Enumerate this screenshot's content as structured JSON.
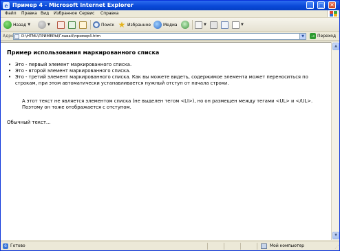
{
  "window": {
    "title": "Пример 4 - Microsoft Internet Explorer",
    "controls": {
      "minimize": "_",
      "maximize": "□",
      "close": "✕"
    }
  },
  "menubar": {
    "items": [
      "Файл",
      "Правка",
      "Вид",
      "Избранное",
      "Сервис",
      "Справка"
    ]
  },
  "toolbar": {
    "back_label": "Назад",
    "search_label": "Поиск",
    "favorites_label": "Избранное",
    "media_label": "Медиа"
  },
  "addressbar": {
    "label": "Адрес:",
    "value": "D:\\HTML\\ПРИМЕРЫ\\Глава4\\пример4.htm",
    "go_label": "Переход"
  },
  "page": {
    "heading": "Пример использования маркированного списка",
    "list_items": [
      "Это - первый элемент маркированного списка.",
      "Это - второй элемент маркированного списка.",
      "Это - третий элемент маркированного списка. Как вы можете видеть, содержимое элемента может переноситься по строкам, при этом автоматически устанавливается нужный отступ от начала строки."
    ],
    "indented_paragraph": "А этот текст не является элементом списка (не выделен тегом <LI>), но он размещен между тегами <UL> и </UL>. Поэтому он тоже отображается с отступом.",
    "plain_paragraph": "Обычный текст..."
  },
  "statusbar": {
    "status": "Готово",
    "zone": "Мой компьютер"
  },
  "colors": {
    "titlebar": "#0a49d8",
    "chrome": "#ece9d8",
    "content_bg": "#ffffff"
  }
}
